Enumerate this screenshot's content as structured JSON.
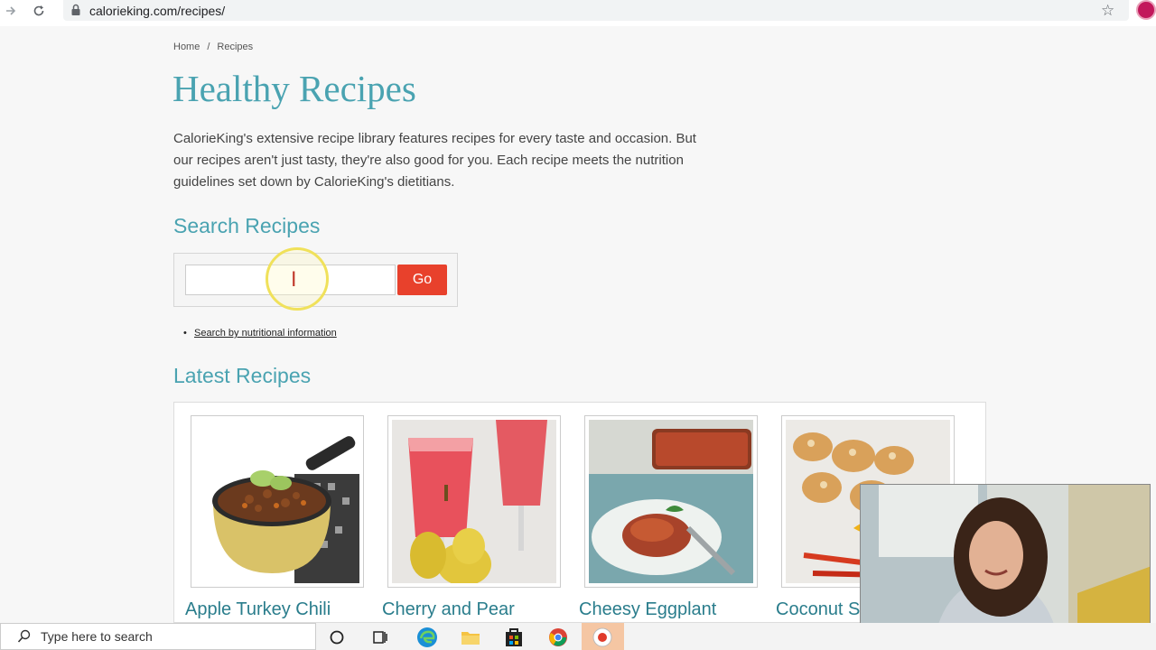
{
  "browser": {
    "url": "calorieking.com/recipes/"
  },
  "breadcrumb": {
    "home": "Home",
    "separator": "/",
    "current": "Recipes"
  },
  "page_title": "Healthy Recipes",
  "intro": "CalorieKing's extensive recipe library features recipes for every taste and occasion. But our recipes aren't just tasty, they're also good for you. Each recipe meets the nutrition guidelines set down by CalorieKing's dietitians.",
  "search": {
    "heading": "Search Recipes",
    "input_value": "",
    "go_label": "Go",
    "nutritional_link": "Search by nutritional information"
  },
  "latest": {
    "heading": "Latest Recipes",
    "recipes": [
      {
        "title": "Apple Turkey Chili"
      },
      {
        "title": "Cherry and Pear"
      },
      {
        "title": "Cheesy Eggplant"
      },
      {
        "title": "Coconut S"
      }
    ]
  },
  "taskbar": {
    "search_placeholder": "Type here to search"
  },
  "colors": {
    "accent": "#4aa3b1",
    "go_button": "#e8412c"
  }
}
